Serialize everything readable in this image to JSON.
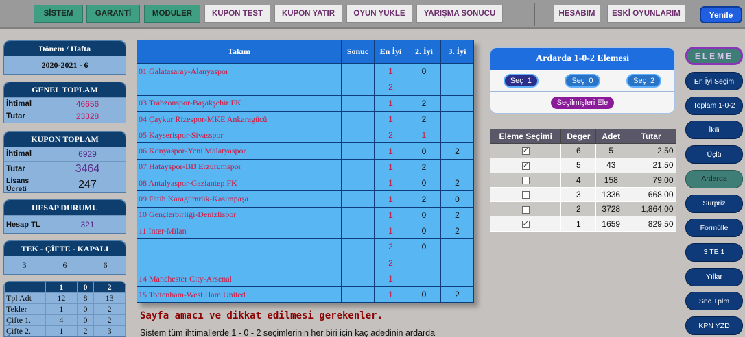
{
  "topnav": {
    "items": [
      "SİSTEM",
      "GARANTİ",
      "MODULER",
      "KUPON TEST",
      "KUPON YATIR",
      "OYUN YUKLE",
      "YARIŞMA SONUCU",
      "HESABIM",
      "ESKİ OYUNLARIM"
    ],
    "refresh_label": "Yenile"
  },
  "donem": {
    "title": "Dönem / Hafta",
    "value": "2020-2021 - 6"
  },
  "genel": {
    "title": "GENEL TOPLAM",
    "ihtimal_label": "İhtimal",
    "ihtimal": "46656",
    "tutar_label": "Tutar",
    "tutar": "23328"
  },
  "kupon": {
    "title": "KUPON TOPLAM",
    "ihtimal_label": "İhtimal",
    "ihtimal": "6929",
    "tutar_label": "Tutar",
    "tutar": "3464",
    "lisans_label": "Lisans Ücreti",
    "lisans": "247"
  },
  "hesap": {
    "title": "HESAP DURUMU",
    "tl_label": "Hesap TL",
    "tl": "321"
  },
  "tekcifte": {
    "title": "TEK - ÇİFTE - KAPALI",
    "values": [
      "3",
      "6",
      "6"
    ]
  },
  "stats": {
    "headers": [
      "",
      "1",
      "0",
      "2"
    ],
    "rows": [
      [
        "Tpl Adt",
        "12",
        "8",
        "13"
      ],
      [
        "Tekler",
        "1",
        "0",
        "2"
      ],
      [
        "Çifte 1.",
        "4",
        "0",
        "2"
      ],
      [
        "Çifte 2.",
        "1",
        "2",
        "3"
      ]
    ]
  },
  "matches": {
    "headers": [
      "Takım",
      "Sonuc",
      "En İyi",
      "2. İyi",
      "3. İyi"
    ],
    "rows": [
      {
        "team": "01 Galatasaray-Alanyaspor",
        "sonuc": "",
        "en": "1",
        "iki": "0",
        "uc": ""
      },
      {
        "team": "",
        "sonuc": "",
        "en": "2",
        "iki": "",
        "uc": ""
      },
      {
        "team": "03 Trabzonspor-Başakşehir FK",
        "sonuc": "",
        "en": "1",
        "iki": "2",
        "uc": ""
      },
      {
        "team": "04 Çaykur Rizespor-MKE Ankaragücü",
        "sonuc": "",
        "en": "1",
        "iki": "2",
        "uc": ""
      },
      {
        "team": "05 Kayserispor-Sivasspor",
        "sonuc": "",
        "en": "2",
        "iki": "1",
        "uc": ""
      },
      {
        "team": "06 Konyaspor-Yeni Malatyaspor",
        "sonuc": "",
        "en": "1",
        "iki": "0",
        "uc": "2"
      },
      {
        "team": "07 Hatayspor-BB Erzurumspor",
        "sonuc": "",
        "en": "1",
        "iki": "2",
        "uc": ""
      },
      {
        "team": "08 Antalyaspor-Gaziantep FK",
        "sonuc": "",
        "en": "1",
        "iki": "0",
        "uc": "2"
      },
      {
        "team": "09 Fatih Karagümrük-Kasımpaşa",
        "sonuc": "",
        "en": "1",
        "iki": "2",
        "uc": "0"
      },
      {
        "team": "10 Gençlerbirliği-Denizlispor",
        "sonuc": "",
        "en": "1",
        "iki": "0",
        "uc": "2"
      },
      {
        "team": "11 Inter-Milan",
        "sonuc": "",
        "en": "1",
        "iki": "0",
        "uc": "2"
      },
      {
        "team": "",
        "sonuc": "",
        "en": "2",
        "iki": "0",
        "uc": ""
      },
      {
        "team": "",
        "sonuc": "",
        "en": "2",
        "iki": "",
        "uc": ""
      },
      {
        "team": "14 Manchester City-Arsenal",
        "sonuc": "",
        "en": "1",
        "iki": "",
        "uc": ""
      },
      {
        "team": "15 Tottenham-West Ham United",
        "sonuc": "",
        "en": "1",
        "iki": "0",
        "uc": "2"
      }
    ]
  },
  "notes": {
    "title": "Sayfa amacı ve dikkat edilmesi gerekenler.",
    "body": "Sistem tüm ihtimallerde 1 - 0 - 2 seçimlerinin her biri için kaç adedinin ardarda"
  },
  "ardarda": {
    "title": "Ardarda 1-0-2 Elemesi",
    "select_buttons": [
      {
        "label": "Seç",
        "value": "1"
      },
      {
        "label": "Seç",
        "value": "0"
      },
      {
        "label": "Seç",
        "value": "2"
      }
    ],
    "eliminate_label": "Seçilmişleri Ele"
  },
  "eleme_table": {
    "headers": [
      "Eleme Seçimi",
      "Deger",
      "Adet",
      "Tutar"
    ],
    "rows": [
      {
        "checked": true,
        "deger": "6",
        "adet": "5",
        "tutar": "2.50"
      },
      {
        "checked": true,
        "deger": "5",
        "adet": "43",
        "tutar": "21.50"
      },
      {
        "checked": false,
        "deger": "4",
        "adet": "158",
        "tutar": "79.00"
      },
      {
        "checked": false,
        "deger": "3",
        "adet": "1336",
        "tutar": "668.00"
      },
      {
        "checked": false,
        "deger": "2",
        "adet": "3728",
        "tutar": "1,864.00"
      },
      {
        "checked": true,
        "deger": "1",
        "adet": "1659",
        "tutar": "829.50"
      }
    ]
  },
  "side_menu": {
    "header": "ELEME",
    "items": [
      "En İyi Seçim",
      "Toplam 1-0-2",
      "İkili",
      "Üçlü",
      "Ardarda",
      "Sürpriz",
      "Formülle",
      "3 TE 1",
      "Yıllar",
      "Snc Tplm",
      "KPN YZD"
    ],
    "active": "Ardarda"
  },
  "colors": {
    "accent": "#1b6fd6",
    "cell_bg": "#58b6f2",
    "team_text": "#d4143c",
    "panel_head": "#0e3e6e",
    "nav_green": "#3e9f83"
  }
}
